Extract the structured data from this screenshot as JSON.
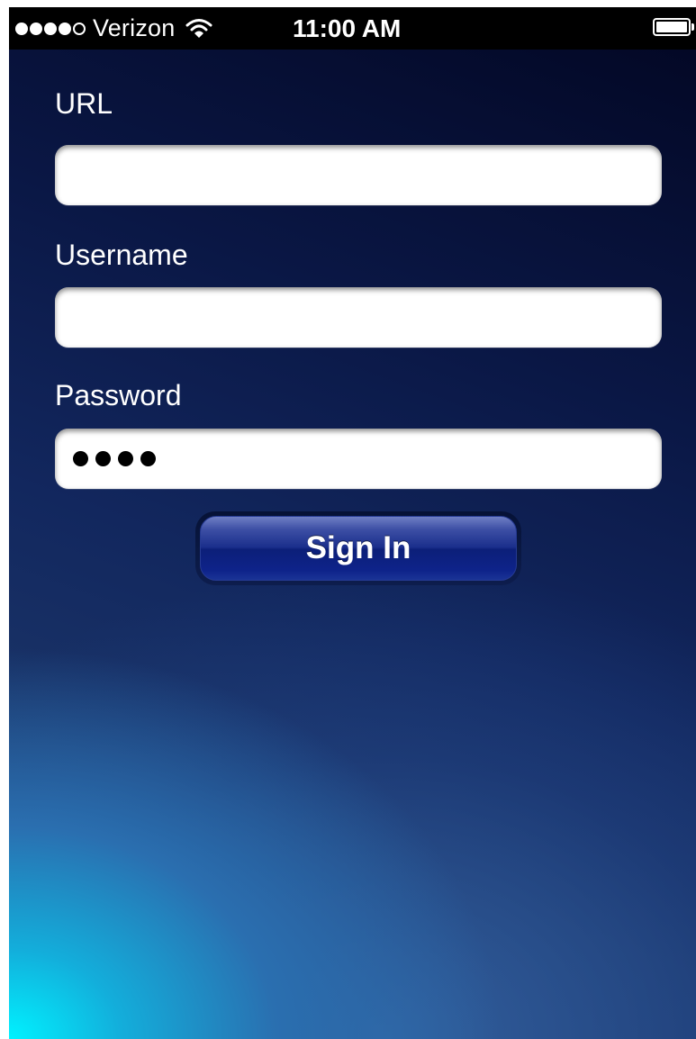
{
  "status_bar": {
    "carrier": "Verizon",
    "time": "11:00 AM",
    "signal_bars_filled": 4,
    "signal_bars_total": 5,
    "battery_level": 1.0
  },
  "form": {
    "url_label": "URL",
    "url_value": "",
    "username_label": "Username",
    "username_value": "",
    "password_label": "Password",
    "password_mask_count": 4,
    "signin_label": "Sign In"
  },
  "colors": {
    "status_bar_bg": "#000000",
    "background_top": "#030826",
    "background_glow": "#00f2ff",
    "button_blue": "#0c1f79"
  },
  "icons": {
    "signal": "signal-strength-icon",
    "wifi": "wifi-icon",
    "battery": "battery-icon"
  }
}
